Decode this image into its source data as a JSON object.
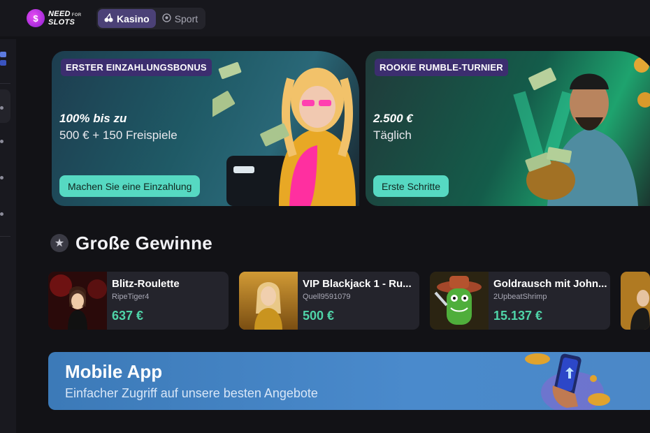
{
  "brand": {
    "logo_line1": "NEED",
    "logo_line1_small": "FOR",
    "logo_line2": "SLOTS"
  },
  "tabs": [
    {
      "label": "Kasino",
      "icon": "cherries-icon",
      "active": true
    },
    {
      "label": "Sport",
      "icon": "soccer-ball-icon",
      "active": false
    }
  ],
  "banners": [
    {
      "tag": "ERSTER EINZAHLUNGSBONUS",
      "headline": "100% bis zu",
      "sub": "500 € + 150 Freispiele",
      "button": "Machen Sie eine Einzahlung"
    },
    {
      "tag": "ROOKIE RUMBLE-TURNIER",
      "headline": "2.500 €",
      "sub": "Täglich",
      "button": "Erste Schritte"
    }
  ],
  "big_wins": {
    "title": "Große Gewinne",
    "items": [
      {
        "game": "Blitz-Roulette",
        "user": "RipeTiger4",
        "amount": "637 €"
      },
      {
        "game": "VIP Blackjack 1 - Ru...",
        "user": "Quell9591079",
        "amount": "500 €"
      },
      {
        "game": "Goldrausch mit John...",
        "user": "2UpbeatShrimp",
        "amount": "15.137 €"
      }
    ]
  },
  "mobile_app": {
    "title": "Mobile App",
    "subtitle": "Einfacher Zugriff auf unsere besten Angebote"
  },
  "colors": {
    "accent": "#56d9c2",
    "win_green": "#4fd4a8",
    "tab_active": "#4b4177",
    "app_blue": "#4a8acc"
  }
}
